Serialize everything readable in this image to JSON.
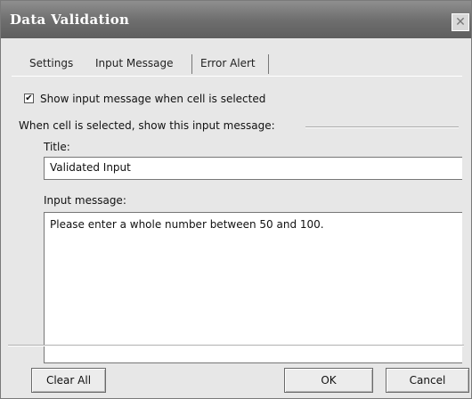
{
  "window": {
    "title": "Data Validation"
  },
  "tabs": [
    {
      "label": "Settings"
    },
    {
      "label": "Input Message"
    },
    {
      "label": "Error Alert"
    }
  ],
  "input_message": {
    "show_checkbox_label": "Show input message when cell is selected",
    "show_checkbox_checked": true,
    "group_label": "When cell is selected, show this input message:",
    "title_label": "Title:",
    "title_value": "Validated Input",
    "message_label": "Input message:",
    "message_value": "Please enter a whole number between 50 and 100."
  },
  "buttons": {
    "clear_all": "Clear All",
    "ok": "OK",
    "cancel": "Cancel"
  },
  "icons": {
    "close": "close-icon"
  }
}
